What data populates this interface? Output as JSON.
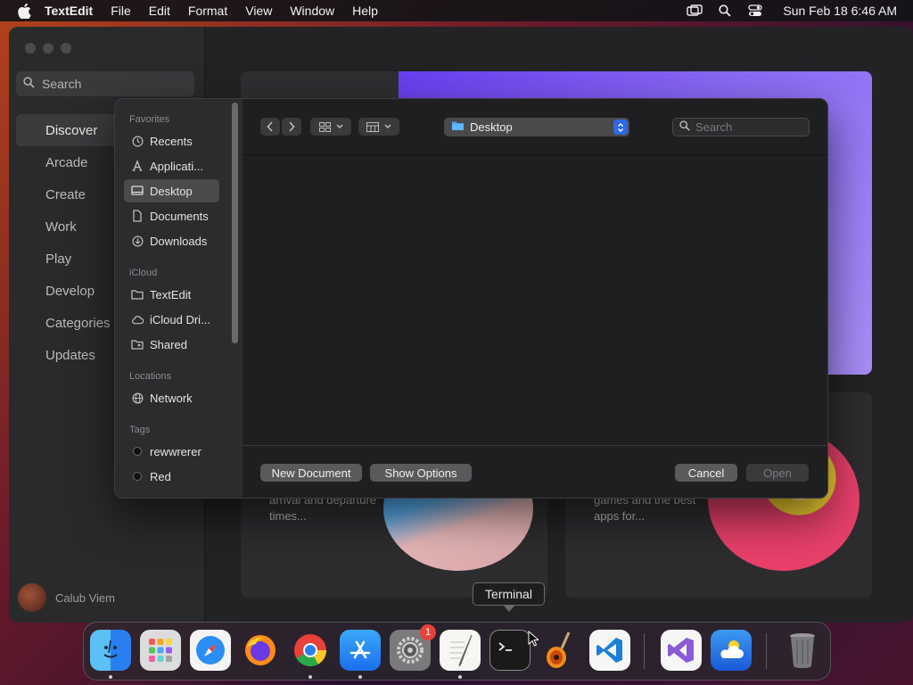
{
  "menubar": {
    "app_name": "TextEdit",
    "items": [
      "File",
      "Edit",
      "Format",
      "View",
      "Window",
      "Help"
    ],
    "datetime": "Sun Feb 18  6:46 AM",
    "icons": [
      "apple-icon",
      "screen-mirror-icon",
      "spotlight-search-icon",
      "control-center-icon"
    ]
  },
  "appstore": {
    "search_placeholder": "Search",
    "nav": [
      "Discover",
      "Arcade",
      "Create",
      "Work",
      "Play",
      "Develop",
      "Categories",
      "Updates"
    ],
    "active_nav": "Discover",
    "user_name": "Calub Viem",
    "card1_text": "arrival and departure times...",
    "card2_text": "games and the best apps for..."
  },
  "dialog": {
    "sidebar": {
      "favorites_title": "Favorites",
      "favorites": [
        "Recents",
        "Applicati...",
        "Desktop",
        "Documents",
        "Downloads"
      ],
      "icloud_title": "iCloud",
      "icloud": [
        "TextEdit",
        "iCloud Dri...",
        "Shared"
      ],
      "locations_title": "Locations",
      "locations": [
        "Network"
      ],
      "tags_title": "Tags",
      "tags": [
        "rewwrerer",
        "Red"
      ]
    },
    "location": "Desktop",
    "search_placeholder": "Search",
    "buttons": {
      "new_document": "New Document",
      "show_options": "Show Options",
      "cancel": "Cancel",
      "open": "Open"
    }
  },
  "tooltip": "Terminal",
  "dock": {
    "apps": [
      "Finder",
      "Launchpad",
      "Safari",
      "Firefox",
      "Chrome",
      "App Store",
      "System Settings",
      "TextEdit",
      "Terminal",
      "GarageBand",
      "VS Code",
      "Visual Studio",
      "Weather",
      "Trash"
    ],
    "settings_badge": "1"
  },
  "colors": {
    "accent": "#2f6ae6",
    "badge": "#e8403a",
    "hero": "#6a3ef0"
  }
}
